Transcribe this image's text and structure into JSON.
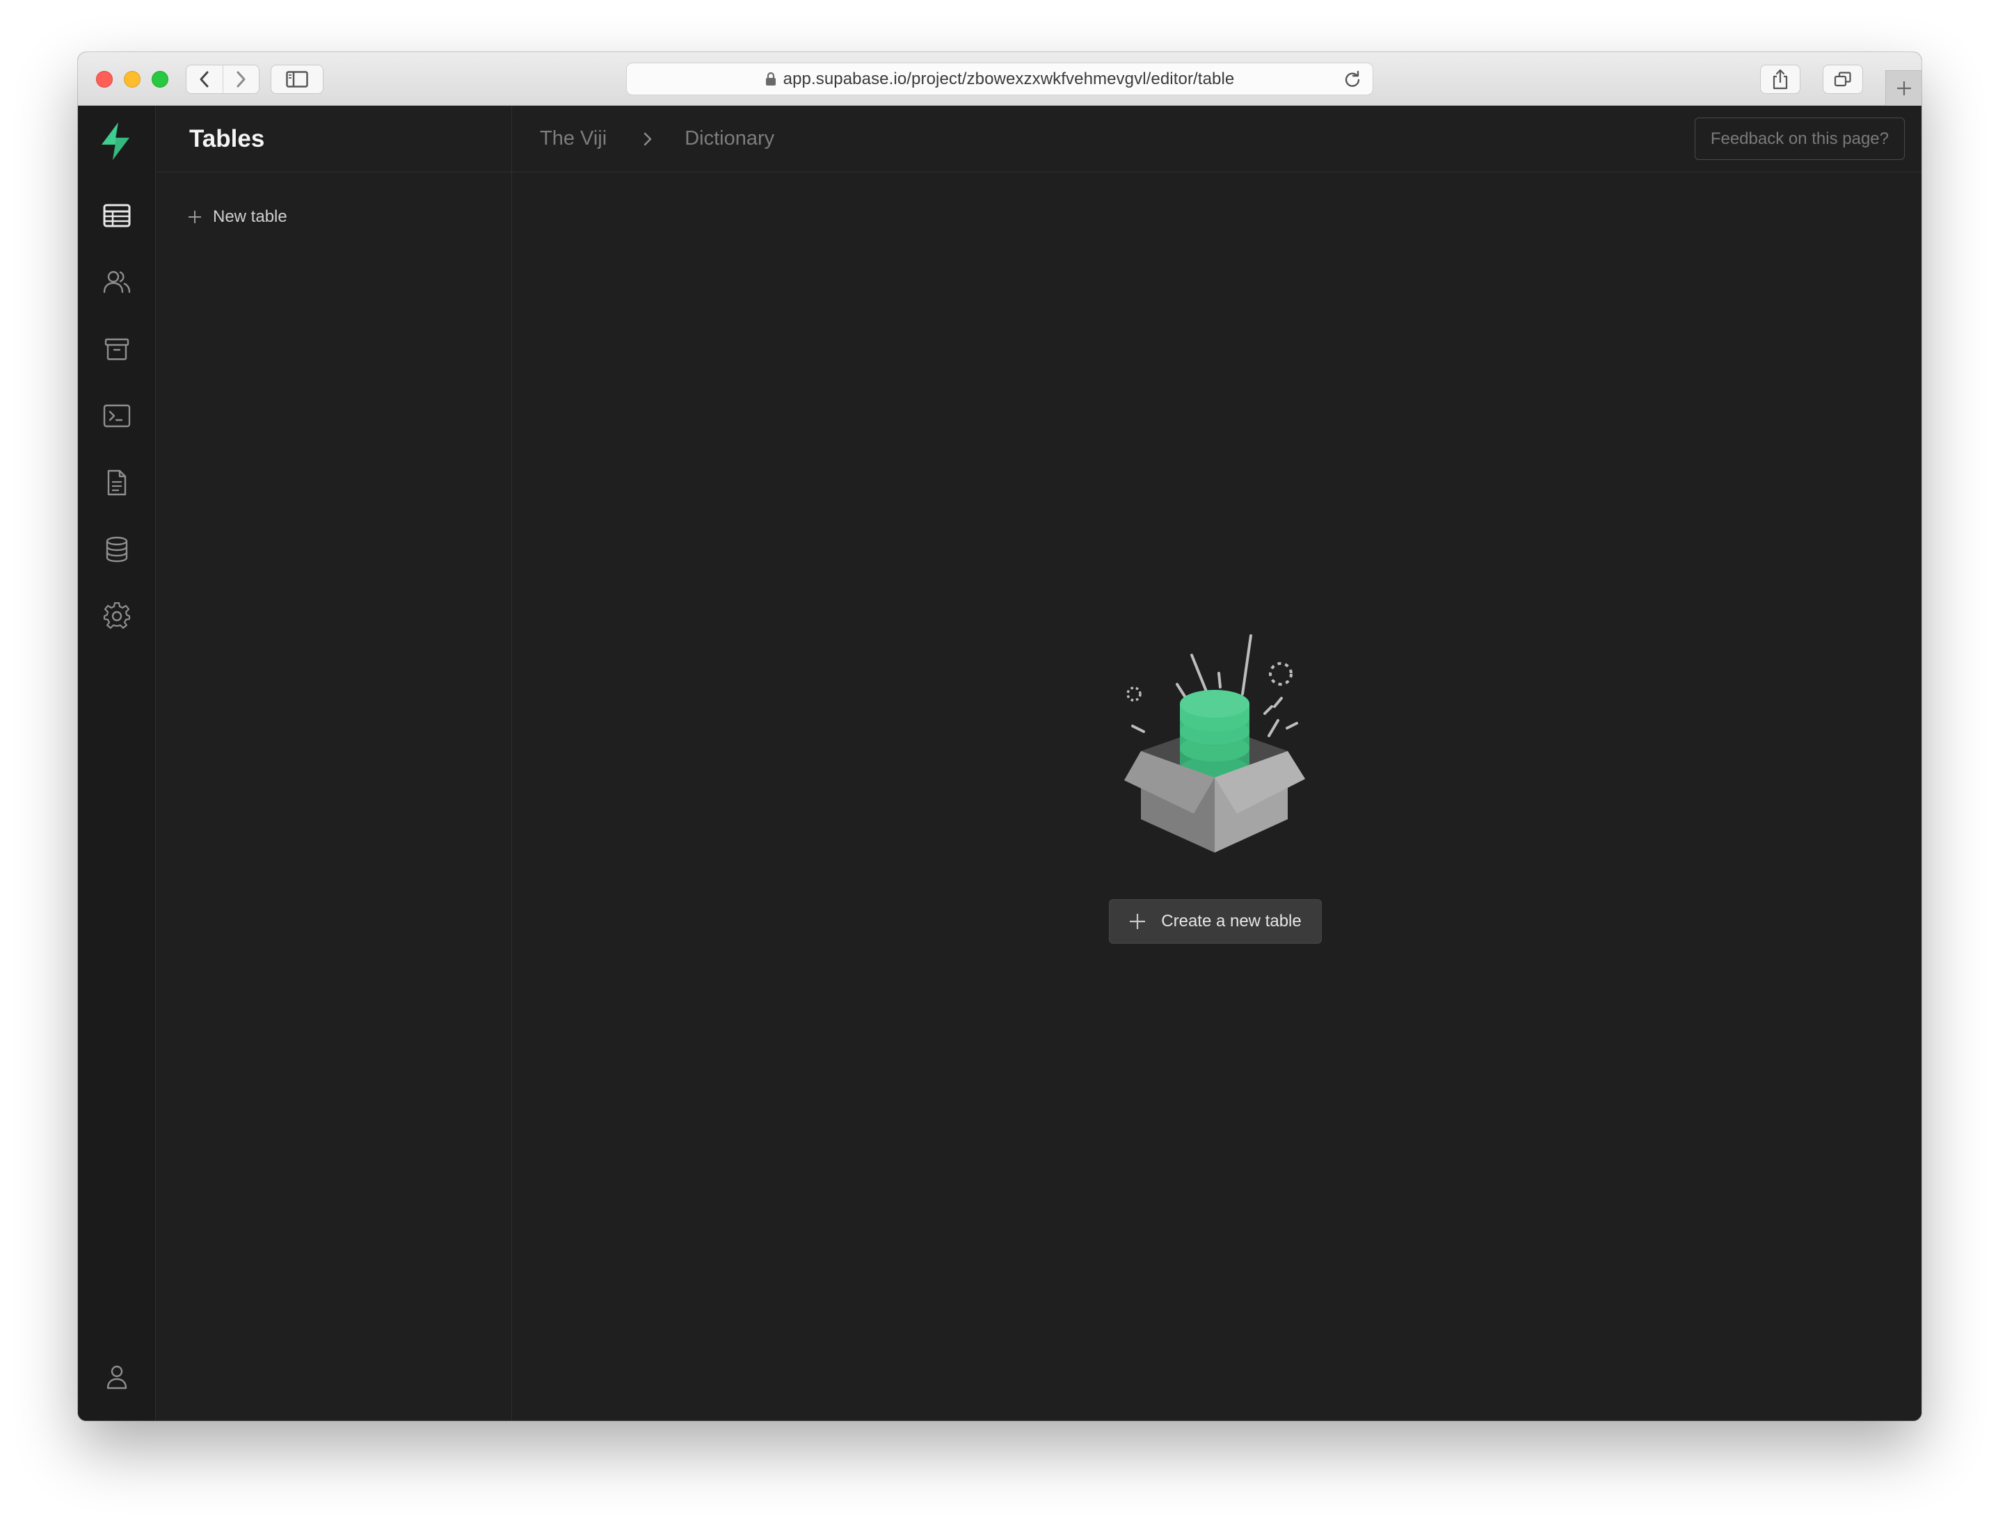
{
  "browser": {
    "url": "app.supabase.io/project/zbowexzxwkfvehmevgvl/editor/table"
  },
  "rail": {
    "items": [
      {
        "icon": "table-icon",
        "active": true
      },
      {
        "icon": "users-icon"
      },
      {
        "icon": "archive-icon"
      },
      {
        "icon": "terminal-icon"
      },
      {
        "icon": "document-icon"
      },
      {
        "icon": "database-icon"
      },
      {
        "icon": "gear-icon"
      }
    ],
    "bottom_icon": "user-icon"
  },
  "panel": {
    "title": "Tables",
    "new_table_label": "New table"
  },
  "breadcrumb": {
    "project": "The Viji",
    "page": "Dictionary"
  },
  "header": {
    "feedback_label": "Feedback on this page?"
  },
  "empty_state": {
    "create_label": "Create a new table"
  },
  "colors": {
    "brand_green": "#3ecf8e",
    "background": "#1f1f1f",
    "rail_background": "#1b1b1b"
  }
}
